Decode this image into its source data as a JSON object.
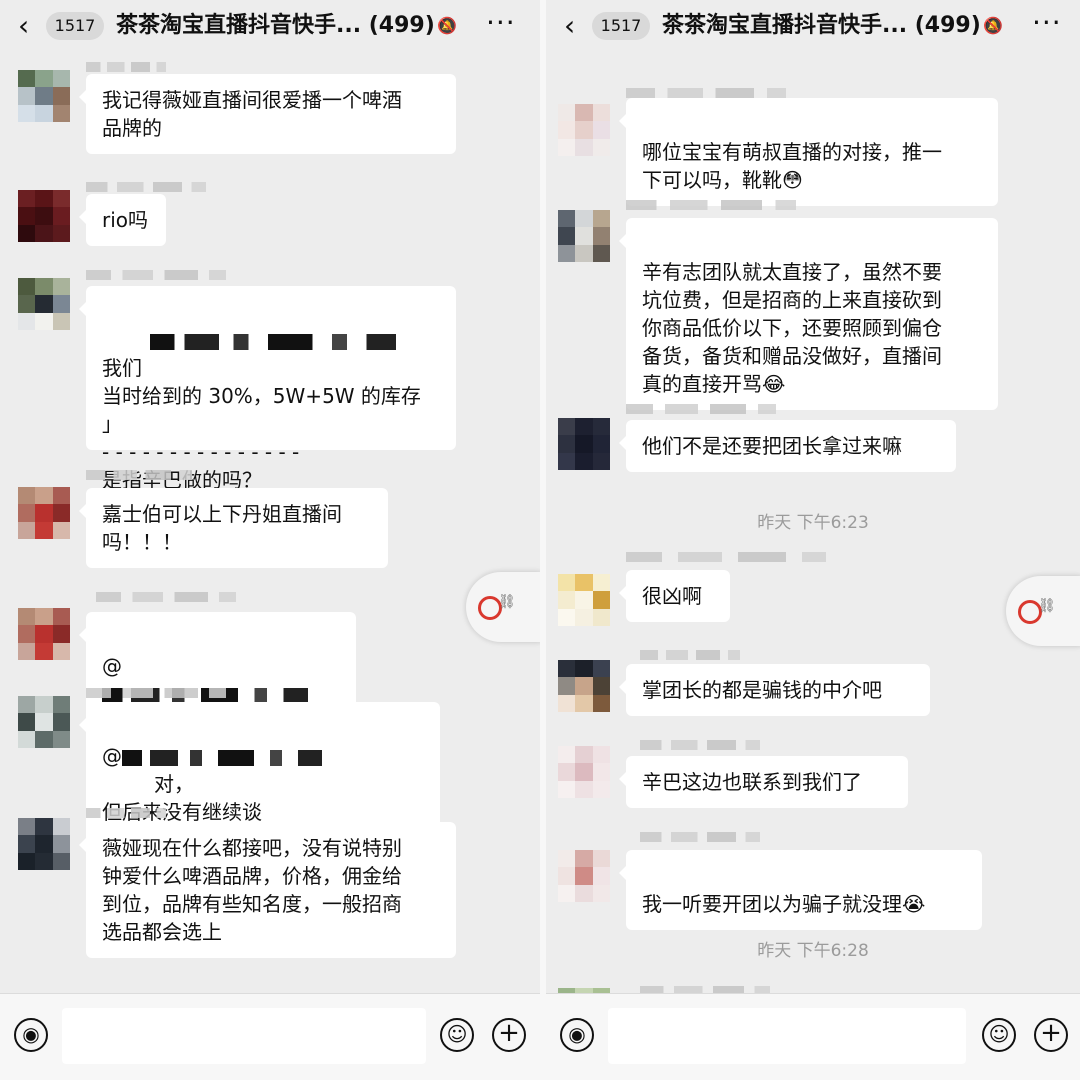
{
  "header": {
    "back_icon": "chevron-left-icon",
    "unread_badge": "1517",
    "title": "茶茶淘宝直播抖音快手... (499)",
    "mute_icon": "bell-slash-icon",
    "more_icon": "ellipsis-icon",
    "more_label": "···"
  },
  "left": {
    "messages": [
      {
        "text": "我记得薇娅直播间很爱播一个啤酒\n品牌的"
      },
      {
        "text": "rio吗"
      },
      {
        "text_after_blur": "我们\n当时给到的 30%，5W+5W 的库存\n」\n- - - - - - - - - - - - - - -\n是指辛巴做的吗？"
      },
      {
        "text": "嘉士伯可以上下丹姐直播间\n吗！！！"
      },
      {
        "text": "@"
      },
      {
        "text_prefix": "@",
        "text_after_blur": "对，\n但后来没有继续谈"
      },
      {
        "text": "薇娅现在什么都接吧，没有说特别\n钟爱什么啤酒品牌，价格，佣金给\n到位，品牌有些知名度，一般招商\n选品都会选上"
      }
    ]
  },
  "right": {
    "messages": [
      {
        "text": "哪位宝宝有萌叔直播的对接，推一\n下可以吗，靴靴",
        "emoji": "😳"
      },
      {
        "text": "辛有志团队就太直接了，虽然不要\n坑位费，但是招商的上来直接砍到\n你商品低价以下，还要照顾到偏仓\n备货，备货和赠品没做好，直播间\n真的直接开骂",
        "emoji": "😂"
      },
      {
        "text": "他们不是还要把团长拿过来嘛"
      },
      {
        "text": "很凶啊"
      },
      {
        "text": "掌团长的都是骗钱的中介吧"
      },
      {
        "text": "辛巴这边也联系到我们了"
      },
      {
        "text": "我一听要开团以为骗子就没理",
        "emoji": "😭"
      }
    ],
    "timestamps": [
      "昨天 下午6:23",
      "昨天 下午6:28"
    ]
  },
  "floating_button": {
    "icon": "mini-program-link-icon"
  },
  "input_bar": {
    "voice_icon": "voice-icon",
    "voice_glyph": "◉",
    "emoji_icon": "emoji-icon",
    "emoji_glyph": "☺",
    "plus_icon": "plus-icon",
    "plus_glyph": "+"
  }
}
